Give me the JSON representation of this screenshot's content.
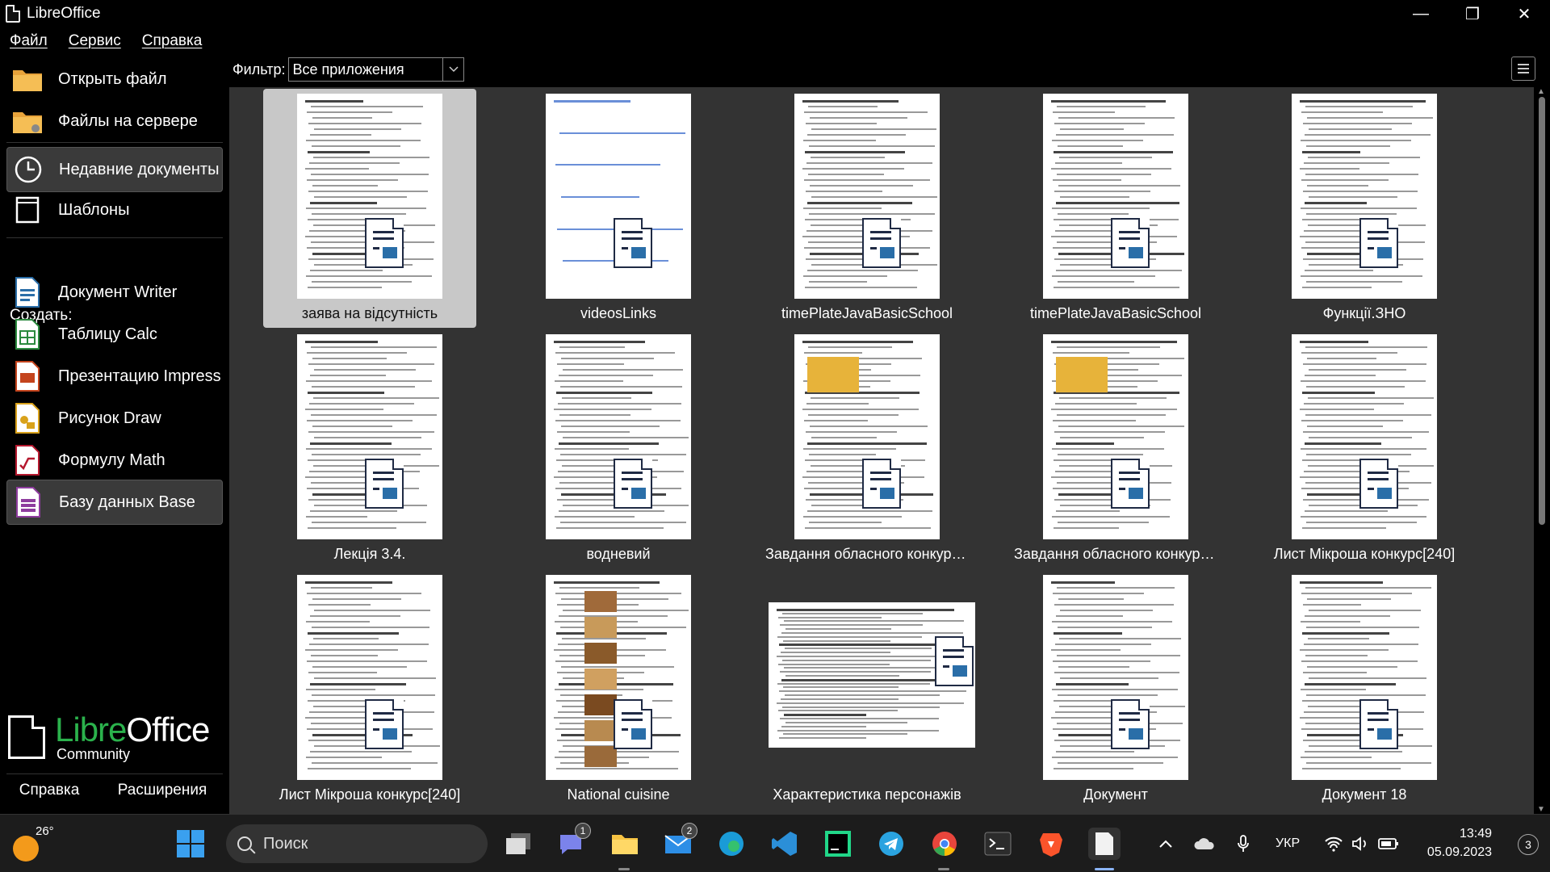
{
  "window": {
    "title": "LibreOffice",
    "minimize": "—",
    "maximize": "❐",
    "close": "✕"
  },
  "menu": {
    "file": "Файл",
    "service": "Сервис",
    "help": "Справка"
  },
  "sidebar": {
    "open_file": "Открыть файл",
    "remote_files": "Файлы на сервере",
    "recent_docs": "Недавние документы",
    "templates": "Шаблоны",
    "create_label": "Создать:",
    "writer": "Документ Writer",
    "calc": "Таблицу Calc",
    "impress": "Презентацию Impress",
    "draw": "Рисунок Draw",
    "math": "Формулу Math",
    "base": "Базу данных Base",
    "logo_libre": "Libre",
    "logo_office": "Office",
    "logo_edition": "Community",
    "help": "Справка",
    "extensions": "Расширения"
  },
  "filter": {
    "label": "Фильтр:",
    "value": "Все приложения"
  },
  "documents": [
    {
      "label": "заява на відсутність",
      "selected": true
    },
    {
      "label": "videosLinks"
    },
    {
      "label": "timePlateJavaBasicSchool"
    },
    {
      "label": "timePlateJavaBasicSchool"
    },
    {
      "label": "Функції.ЗНО"
    },
    {
      "label": "Лекція 3.4."
    },
    {
      "label": "водневий"
    },
    {
      "label": "Завдання  обласного конкурс..."
    },
    {
      "label": "Завдання  обласного конкурс..."
    },
    {
      "label": "Лист Мікроша конкурс[240]"
    },
    {
      "label": "Лист Мікроша конкурс[240]"
    },
    {
      "label": "National cuisine"
    },
    {
      "label": "Характеристика персонажів"
    },
    {
      "label": "Документ"
    },
    {
      "label": "Документ 18"
    }
  ],
  "taskbar": {
    "temperature": "26°",
    "search_placeholder": "Поиск",
    "teams_badge": "1",
    "mail_badge": "2",
    "language": "УКР",
    "time": "13:49",
    "date": "05.09.2023",
    "notifications": "3"
  },
  "colors": {
    "libre_green": "#2bb24c",
    "doc_badge_blue": "#2a6ea8"
  }
}
